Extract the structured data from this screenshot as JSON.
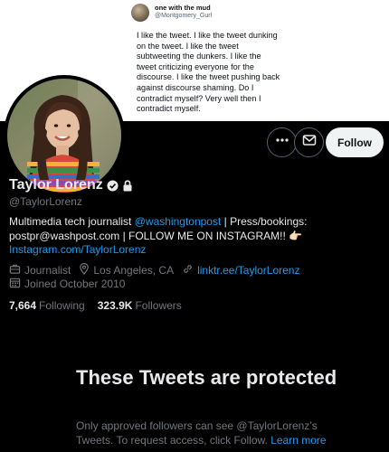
{
  "banner_tweet": {
    "name": "one with the mud",
    "handle": "@Montgomery_Gurl",
    "text": "I like the tweet. I like the tweet dunking on the tweet. I like the tweet subtweeting the dunkers. I like the tweet criticizing everyone for the discourse. I like the tweet pushing back against discourse shaming. Do I contradict myself? Very well then I contradict myself."
  },
  "actions": {
    "more_icon": "more-horizontal-icon",
    "message_icon": "envelope-icon",
    "follow_label": "Follow"
  },
  "profile": {
    "display_name": "Taylor Lorenz",
    "handle": "@TaylorLorenz",
    "bio": {
      "part1": "Multimedia tech journalist ",
      "mention": "@washingtonpost",
      "part2": " | Press/bookings: postpr@washpost.com | FOLLOW ME ON INSTAGRAM!! 👉🏻 ",
      "link": "Instagram.com/TaylorLorenz"
    },
    "category": "Journalist",
    "location": "Los Angeles, CA",
    "website": "linktr.ee/TaylorLorenz",
    "joined": "Joined October 2010",
    "following_count": "7,664",
    "following_label": "Following",
    "followers_count": "323.9K",
    "followers_label": "Followers"
  },
  "protected": {
    "title": "These Tweets are protected",
    "description": "Only approved followers can see @TaylorLorenz’s Tweets. To request access, click Follow. ",
    "learn_more": "Learn more"
  },
  "colors": {
    "background": "#000000",
    "text": "#e7e9ea",
    "muted": "#71767b",
    "link": "#1d9bf0",
    "follow_button": "#eff3f4"
  }
}
